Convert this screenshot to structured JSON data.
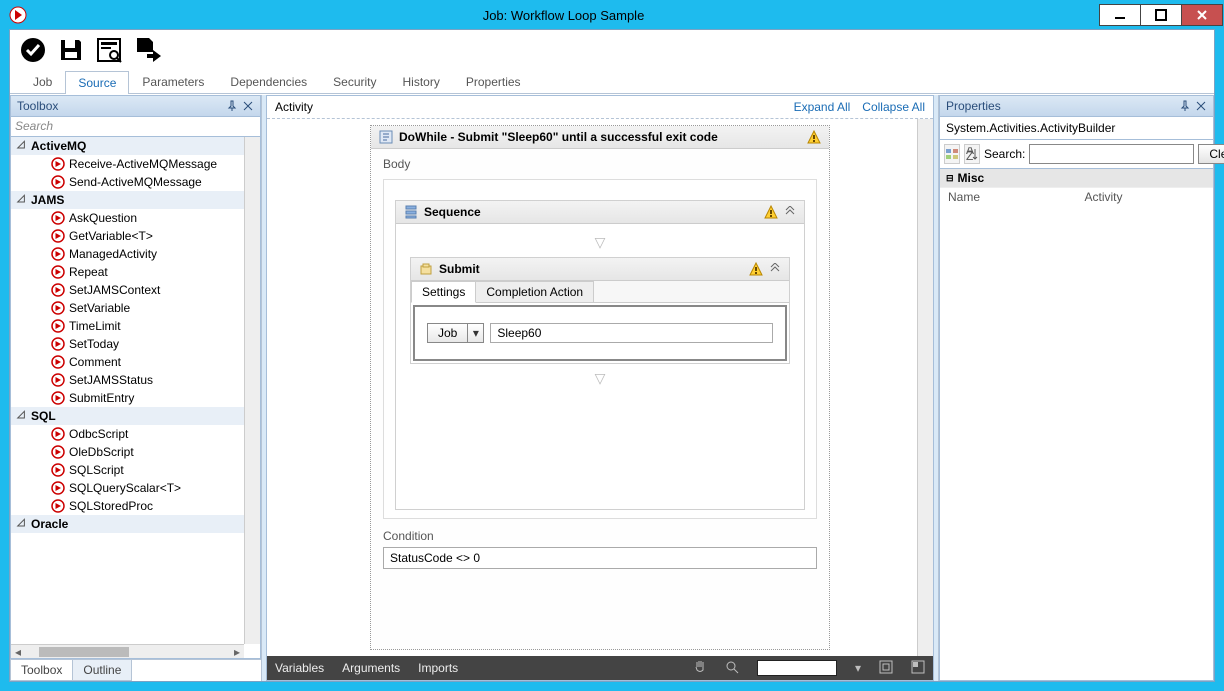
{
  "window": {
    "title": "Job: Workflow Loop Sample"
  },
  "tabs": {
    "items": [
      "Job",
      "Source",
      "Parameters",
      "Dependencies",
      "Security",
      "History",
      "Properties"
    ],
    "active_index": 1
  },
  "toolbox": {
    "title": "Toolbox",
    "search_placeholder": "Search",
    "categories": [
      {
        "name": "ActiveMQ",
        "items": [
          "Receive-ActiveMQMessage",
          "Send-ActiveMQMessage"
        ]
      },
      {
        "name": "JAMS",
        "items": [
          "AskQuestion",
          "GetVariable<T>",
          "ManagedActivity",
          "Repeat",
          "SetJAMSContext",
          "SetVariable",
          "TimeLimit",
          "SetToday",
          "Comment",
          "SetJAMSStatus",
          "SubmitEntry"
        ]
      },
      {
        "name": "SQL",
        "items": [
          "OdbcScript",
          "OleDbScript",
          "SQLScript",
          "SQLQueryScalar<T>",
          "SQLStoredProc"
        ]
      },
      {
        "name": "Oracle",
        "items": []
      }
    ],
    "bottom_tabs": [
      "Toolbox",
      "Outline"
    ],
    "bottom_active": 0
  },
  "designer": {
    "breadcrumb": "Activity",
    "expand_all": "Expand All",
    "collapse_all": "Collapse All",
    "dowhile_title": "DoWhile - Submit \"Sleep60\" until a successful exit code",
    "body_label": "Body",
    "sequence_title": "Sequence",
    "submit_title": "Submit",
    "submit_tabs": [
      "Settings",
      "Completion Action"
    ],
    "submit_active_tab": 0,
    "job_combo_label": "Job",
    "job_value": "Sleep60",
    "condition_label": "Condition",
    "condition_value": "StatusCode <> 0",
    "footer": {
      "variables": "Variables",
      "arguments": "Arguments",
      "imports": "Imports"
    }
  },
  "properties": {
    "title": "Properties",
    "type": "System.Activities.ActivityBuilder",
    "search_label": "Search:",
    "clear_label": "Clear",
    "misc_label": "Misc",
    "rows": [
      {
        "k": "Name",
        "v": "Activity"
      }
    ]
  }
}
